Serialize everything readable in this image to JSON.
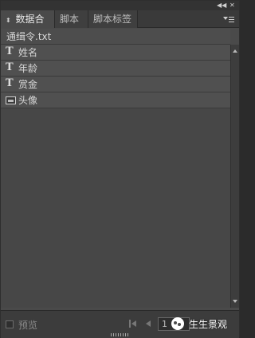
{
  "panel": {
    "tabs": [
      {
        "label": "数据合并",
        "active": true
      },
      {
        "label": "脚本",
        "active": false
      },
      {
        "label": "脚本标签",
        "active": false
      }
    ]
  },
  "source_file": {
    "name": "通缉令.txt"
  },
  "fields": [
    {
      "icon": "text-field-icon",
      "label": "姓名"
    },
    {
      "icon": "text-field-icon",
      "label": "年龄"
    },
    {
      "icon": "text-field-icon",
      "label": "赏金"
    },
    {
      "icon": "image-field-icon",
      "label": "头像"
    }
  ],
  "footer": {
    "preview_label": "预览",
    "page_number": "1"
  },
  "watermark": {
    "text": "生生景观"
  }
}
